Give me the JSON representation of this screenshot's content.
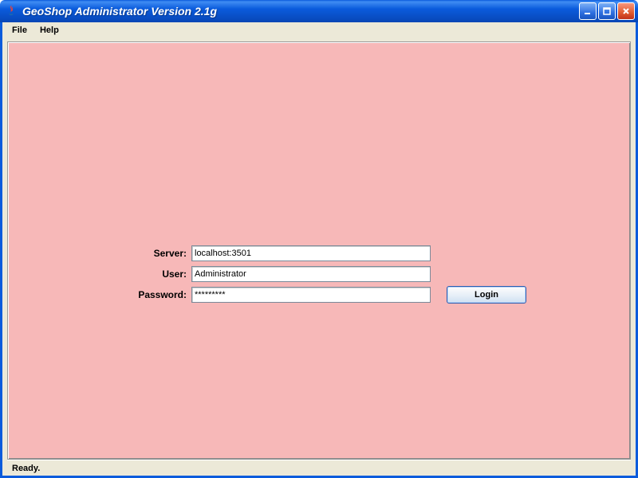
{
  "window": {
    "title": "GeoShop Administrator Version 2.1g"
  },
  "menu": {
    "file": "File",
    "help": "Help"
  },
  "form": {
    "server_label": "Server:",
    "server_value": "localhost:3501",
    "user_label": "User:",
    "user_value": "Administrator",
    "password_label": "Password:",
    "password_value": "*********",
    "login_label": "Login"
  },
  "status": {
    "text": "Ready."
  }
}
